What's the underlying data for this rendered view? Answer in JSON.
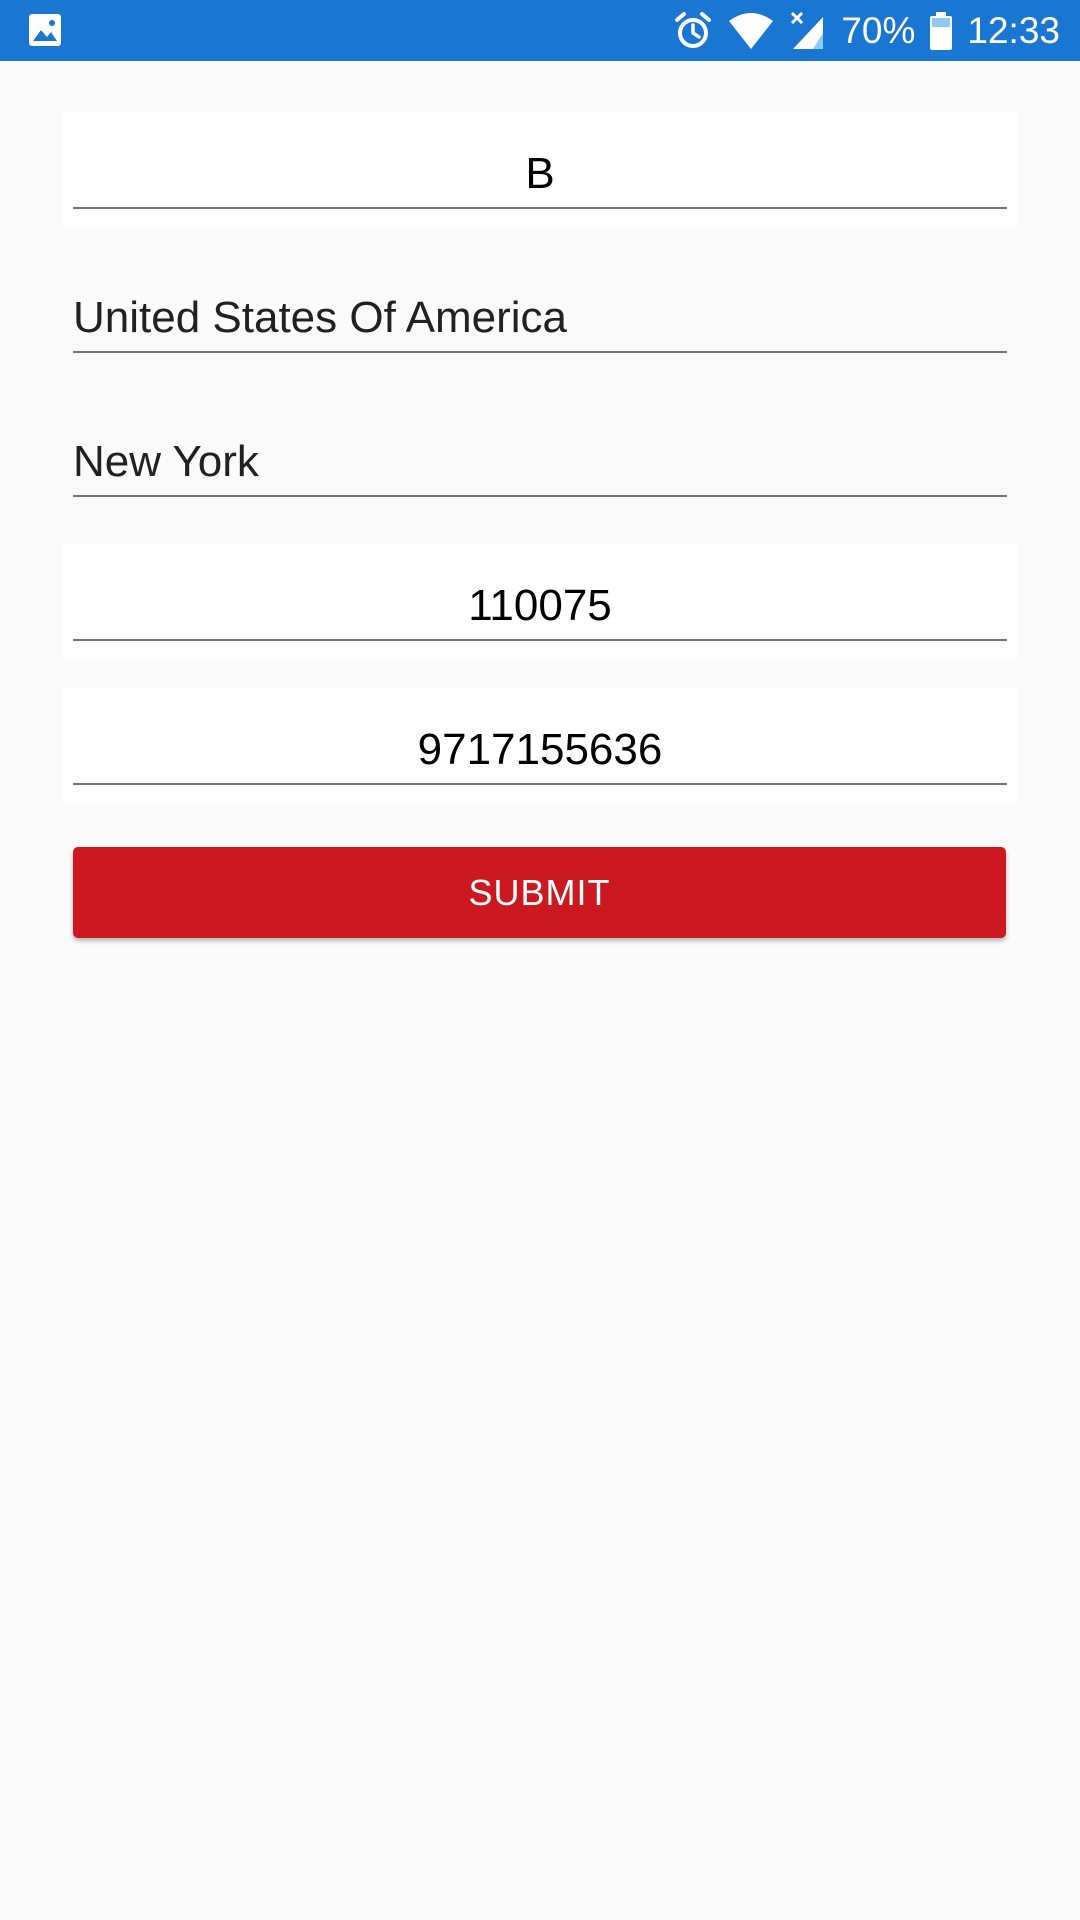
{
  "status_bar": {
    "battery_percent": "70%",
    "time": "12:33",
    "icons": [
      "image-icon",
      "alarm-icon",
      "wifi-icon",
      "signal-icon",
      "battery-icon"
    ],
    "background_color": "#1976d2"
  },
  "form": {
    "fields": [
      {
        "name": "name",
        "value": "B"
      },
      {
        "name": "country",
        "value": "United States Of America"
      },
      {
        "name": "city",
        "value": "New York"
      },
      {
        "name": "pincode",
        "value": "110075"
      },
      {
        "name": "phone",
        "value": "9717155636"
      }
    ],
    "submit_label": "SUBMIT",
    "submit_color": "#cc1820"
  }
}
